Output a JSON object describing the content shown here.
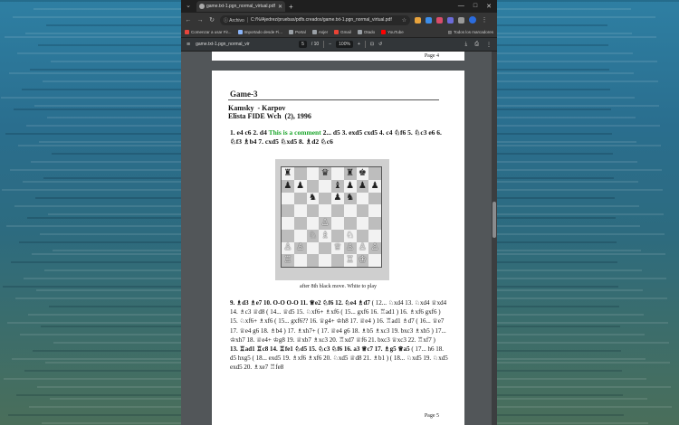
{
  "browser": {
    "tab_title": "game.txt-1.pgn_normal_virtual.pdf",
    "window_controls": [
      "—",
      "□",
      "✕"
    ],
    "address_chip": "Archivo",
    "url": "C:/%/Ajedrez/pruebas/pdfs.creados/game.txt-1.pgn_normal_virtual.pdf",
    "bookmarks": [
      {
        "label": "Comenzar a usar Fir...",
        "color": "#e8453c"
      },
      {
        "label": "Importado desde Fi...",
        "color": "#8ab4f8"
      },
      {
        "label": "Portal",
        "color": "#9aa0a6"
      },
      {
        "label": "Asjer",
        "color": "#9aa0a6"
      },
      {
        "label": "Gmail",
        "color": "#ea4335"
      },
      {
        "label": "Otado",
        "color": "#9aa0a6"
      },
      {
        "label": "YouTube",
        "color": "#ff0000"
      }
    ],
    "all_bookmarks": "Todos los marcadores"
  },
  "pdf_toolbar": {
    "title": "game.txt-1.pgn_normal_virtual.pdf",
    "page_current": "5",
    "page_total": "/ 10",
    "zoom": "100%"
  },
  "document": {
    "prev_page_label": "Page 4",
    "game_heading": "Game-3",
    "players": "Kamsky  - Karpov",
    "event": "Elista FIDE Wch  (2), 1996",
    "moves_part1": "1. e4 c6 2. d4 ",
    "comment": "This is a comment",
    "moves_part2": " 2... d5 3. exd5 cxd5 4. c4 ♘f6 5. ♘c3 e6 6. ♘f3 ♗b4 7. cxd5 ♘xd5 8. ♗d2 ♘c6",
    "caption": "after 8th black move. White to play",
    "moves_bold": "9. ♗d3 ♗e7 10. O-O O-O 11. ♕e2 ♘f6 12. ♘e4 ♗d7",
    "variation1": " ( 12... ♘xd4 13. ♘xd4 ♕xd4 14. ♗c3 ♕d8 ( 14... ♕d5 15. ♘xf6+ ♗xf6 ( 15... gxf6 16. ♖ad1 ) 16. ♗xf6 gxf6 ) 15. ♘xf6+ ♗xf6 ( 15... gxf6?? 16. ♕g4+ ♔h8 17. ♕e4 ) 16. ♖ad1 ♗d7 ( 16... ♕e7 17. ♕e4 g6 18. ♗b4 ) 17. ♗xh7+ ( 17. ♕e4 g6 18. ♗b5 ♗xc3 19. bxc3 ♗xb5 ) 17... ♔xh7 18. ♕e4+ ♔g8 19. ♕xb7 ♗xc3 20. ♖xd7 ♕f6 21. bxc3 ♕xc3 22. ♖xf7 )",
    "moves_bold2": "13. ♖ad1 ♖c8 14. ♖fe1 ♘d5 15. ♘c3 ♘f6 16. a3 ♕c7 17. ♗g5 ♕a5",
    "variation2": " ( 17... h6 18. d5 hxg5 ( 18... exd5 19. ♗xf6 ♗xf6 20. ♘xd5 ♕d8 21. ♗b1 ) ( 18... ♘xd5 19. ♘xd5 exd5 20. ♗xe7 ♖fe8",
    "page_label": "Page 5"
  },
  "board": [
    [
      "♜",
      "",
      "",
      "♛",
      "",
      "♜",
      "♚",
      ""
    ],
    [
      "♟",
      "♟",
      "",
      "",
      "♝",
      "♟",
      "♟",
      "♟"
    ],
    [
      "",
      "",
      "♞",
      "",
      "♟",
      "♞",
      "",
      ""
    ],
    [
      "",
      "",
      "",
      "",
      "",
      "",
      "",
      ""
    ],
    [
      "",
      "",
      "",
      "♙",
      "",
      "",
      "",
      ""
    ],
    [
      "",
      "",
      "♘",
      "♗",
      "",
      "♘",
      "",
      ""
    ],
    [
      "♙",
      "♙",
      "",
      "",
      "♕",
      "♙",
      "♙",
      "♙"
    ],
    [
      "♖",
      "",
      "",
      "",
      "",
      "♖",
      "♔",
      ""
    ]
  ]
}
